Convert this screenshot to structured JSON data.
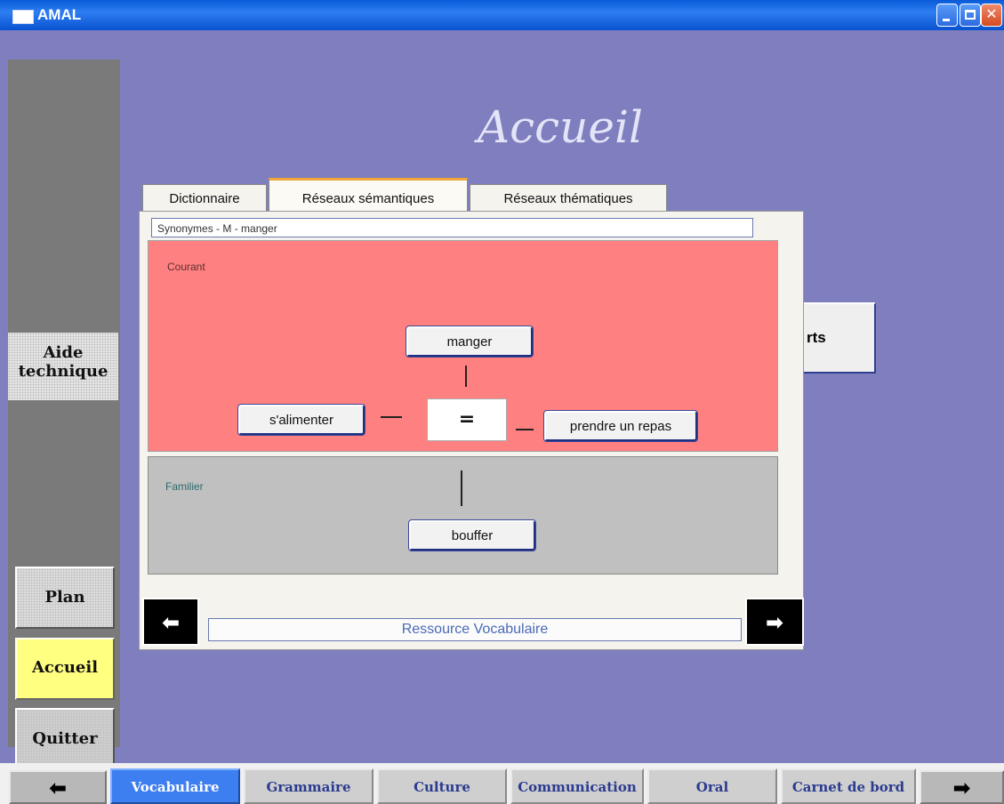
{
  "window": {
    "title": "AMAL"
  },
  "page": {
    "title": "Accueil"
  },
  "sidebar": {
    "aide_line1": "Aide",
    "aide_line2": "technique",
    "plan": "Plan",
    "accueil": "Accueil",
    "quitter": "Quitter"
  },
  "behind_button": {
    "label": "rts"
  },
  "dialog": {
    "tabs": [
      "Dictionnaire",
      "Réseaux sémantiques",
      "Réseaux thématiques"
    ],
    "active_tab": "Réseaux sémantiques",
    "header_field": "Synonymes - M - manger",
    "zones": {
      "courant": "Courant",
      "familier": "Familier"
    },
    "words": {
      "center": "manger",
      "left": "s'alimenter",
      "right": "prendre un repas",
      "familier": "bouffer"
    },
    "equals": "=",
    "footer_label": "Ressource Vocabulaire"
  },
  "bottom_tabs": [
    "Vocabulaire",
    "Grammaire",
    "Culture",
    "Communication",
    "Oral",
    "Carnet de bord"
  ],
  "active_bottom_tab": "Vocabulaire",
  "icons": {
    "prev": "left-arrow-icon",
    "next": "right-arrow-icon"
  },
  "colors": {
    "background": "#7f7fbf",
    "courant_zone": "#ff8080",
    "familier_zone": "#c0c0c0",
    "accueil_button": "#ffff80",
    "active_tab": "#3d7ef0"
  }
}
